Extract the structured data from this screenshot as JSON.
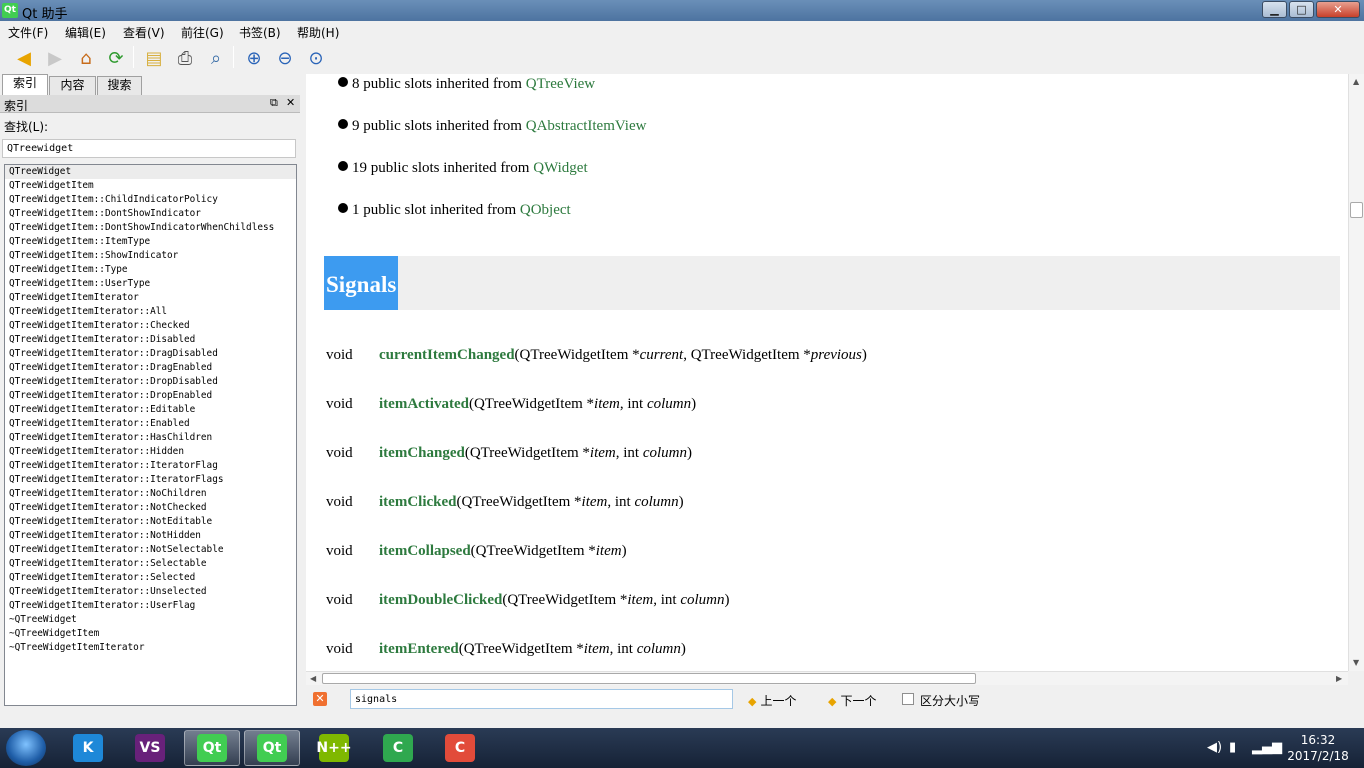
{
  "window": {
    "title": "Qt 助手",
    "app_icon_label": "Qt",
    "minimize": "▁",
    "maximize": "□",
    "close": "✕"
  },
  "menu": [
    "文件(F)",
    "编辑(E)",
    "查看(V)",
    "前往(G)",
    "书签(B)",
    "帮助(H)"
  ],
  "toolbar_icons": [
    "back-icon",
    "forward-icon",
    "home-icon",
    "sync-icon",
    "bookmark-icon",
    "print-icon",
    "find-icon",
    "zoom-in-icon",
    "zoom-out-icon",
    "zoom-reset-icon"
  ],
  "left_panel": {
    "tabs": [
      "索引",
      "内容",
      "搜索"
    ],
    "panel_title": "索引",
    "find_label": "查找(L):",
    "find_value": "QTreewidget",
    "items": [
      "QTreeWidget",
      "QTreeWidgetItem",
      "QTreeWidgetItem::ChildIndicatorPolicy",
      "QTreeWidgetItem::DontShowIndicator",
      "QTreeWidgetItem::DontShowIndicatorWhenChildless",
      "QTreeWidgetItem::ItemType",
      "QTreeWidgetItem::ShowIndicator",
      "QTreeWidgetItem::Type",
      "QTreeWidgetItem::UserType",
      "QTreeWidgetItemIterator",
      "QTreeWidgetItemIterator::All",
      "QTreeWidgetItemIterator::Checked",
      "QTreeWidgetItemIterator::Disabled",
      "QTreeWidgetItemIterator::DragDisabled",
      "QTreeWidgetItemIterator::DragEnabled",
      "QTreeWidgetItemIterator::DropDisabled",
      "QTreeWidgetItemIterator::DropEnabled",
      "QTreeWidgetItemIterator::Editable",
      "QTreeWidgetItemIterator::Enabled",
      "QTreeWidgetItemIterator::HasChildren",
      "QTreeWidgetItemIterator::Hidden",
      "QTreeWidgetItemIterator::IteratorFlag",
      "QTreeWidgetItemIterator::IteratorFlags",
      "QTreeWidgetItemIterator::NoChildren",
      "QTreeWidgetItemIterator::NotChecked",
      "QTreeWidgetItemIterator::NotEditable",
      "QTreeWidgetItemIterator::NotHidden",
      "QTreeWidgetItemIterator::NotSelectable",
      "QTreeWidgetItemIterator::Selectable",
      "QTreeWidgetItemIterator::Selected",
      "QTreeWidgetItemIterator::Unselected",
      "QTreeWidgetItemIterator::UserFlag",
      "~QTreeWidget",
      "~QTreeWidgetItem",
      "~QTreeWidgetItemIterator"
    ]
  },
  "content": {
    "inherited": [
      {
        "text": "8 public slots inherited from ",
        "link": "QTreeView"
      },
      {
        "text": "9 public slots inherited from ",
        "link": "QAbstractItemView"
      },
      {
        "text": "19 public slots inherited from ",
        "link": "QWidget"
      },
      {
        "text": "1 public slot inherited from ",
        "link": "QObject"
      }
    ],
    "section_heading": "Signals",
    "signals": [
      {
        "ret": "void",
        "name": "currentItemChanged",
        "params": [
          {
            "t": "(QTreeWidgetItem *",
            "i": "current"
          },
          {
            "t": ", QTreeWidgetItem *",
            "i": "previous"
          },
          {
            "t": ")",
            "i": ""
          }
        ]
      },
      {
        "ret": "void",
        "name": "itemActivated",
        "params": [
          {
            "t": "(QTreeWidgetItem *",
            "i": "item"
          },
          {
            "t": ", int ",
            "i": "column"
          },
          {
            "t": ")",
            "i": ""
          }
        ]
      },
      {
        "ret": "void",
        "name": "itemChanged",
        "params": [
          {
            "t": "(QTreeWidgetItem *",
            "i": "item"
          },
          {
            "t": ", int ",
            "i": "column"
          },
          {
            "t": ")",
            "i": ""
          }
        ]
      },
      {
        "ret": "void",
        "name": "itemClicked",
        "params": [
          {
            "t": "(QTreeWidgetItem *",
            "i": "item"
          },
          {
            "t": ", int ",
            "i": "column"
          },
          {
            "t": ")",
            "i": ""
          }
        ]
      },
      {
        "ret": "void",
        "name": "itemCollapsed",
        "params": [
          {
            "t": "(QTreeWidgetItem *",
            "i": "item"
          },
          {
            "t": ")",
            "i": ""
          }
        ]
      },
      {
        "ret": "void",
        "name": "itemDoubleClicked",
        "params": [
          {
            "t": "(QTreeWidgetItem *",
            "i": "item"
          },
          {
            "t": ", int ",
            "i": "column"
          },
          {
            "t": ")",
            "i": ""
          }
        ]
      },
      {
        "ret": "void",
        "name": "itemEntered",
        "params": [
          {
            "t": "(QTreeWidgetItem *",
            "i": "item"
          },
          {
            "t": ", int ",
            "i": "column"
          },
          {
            "t": ")",
            "i": ""
          }
        ]
      }
    ]
  },
  "findbar": {
    "value": "signals",
    "previous": "上一个",
    "next": "下一个",
    "case_sensitive": "区分大小写",
    "case_sensitive_checked": false
  },
  "taskbar": {
    "apps": [
      {
        "name": "k-app",
        "label": "K",
        "color": "#1e88d8"
      },
      {
        "name": "visual-studio",
        "label": "VS",
        "color": "#68217a"
      },
      {
        "name": "qt-assistant",
        "label": "Qt",
        "color": "#41cd52"
      },
      {
        "name": "qt-creator",
        "label": "Qt",
        "color": "#41cd52"
      },
      {
        "name": "notepad-plus",
        "label": "N++",
        "color": "#7fb800"
      },
      {
        "name": "camtasia-green",
        "label": "C",
        "color": "#2fa84f"
      },
      {
        "name": "camtasia-recorder",
        "label": "C",
        "color": "#e24b3a"
      }
    ],
    "time": "16:32",
    "date": "2017/2/18"
  }
}
